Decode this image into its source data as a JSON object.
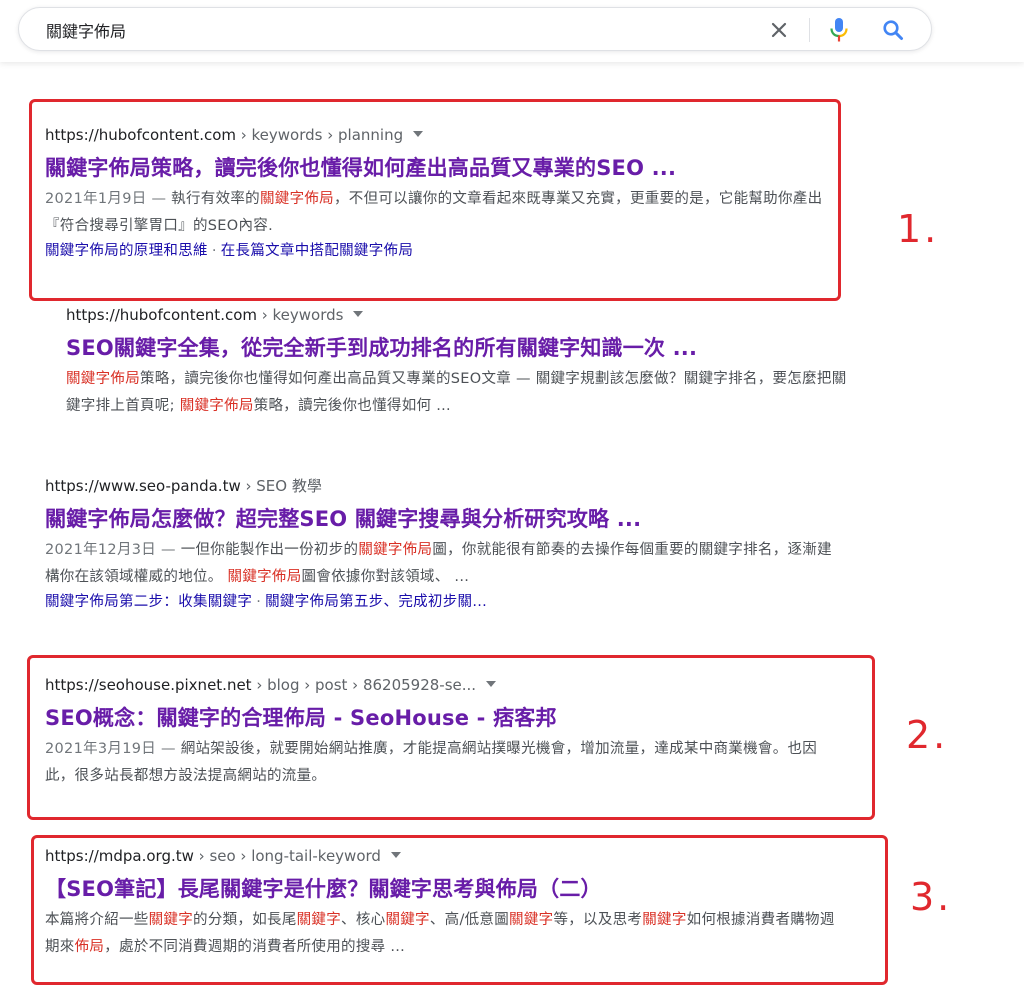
{
  "search": {
    "query": "關鍵字佈局",
    "clear_icon": "close-icon",
    "mic_icon": "microphone-icon",
    "search_icon": "search-icon"
  },
  "results": [
    {
      "url": "https://hubofcontent.com",
      "crumbs": " › keywords › planning",
      "title": "關鍵字佈局策略，讀完後你也懂得如何產出高品質又專業的SEO ...",
      "date": "2021年1月9日 — ",
      "snippet": [
        {
          "t": "執行有效率的",
          "hl": false
        },
        {
          "t": "關鍵字佈局",
          "hl": true
        },
        {
          "t": "，不但可以讓你的文章看起來既專業又充實，更重要的是，它能幫助你產出『符合搜尋引擎胃口』的SEO內容.",
          "hl": false
        }
      ],
      "sitelinks": [
        "關鍵字佈局的原理和思維",
        "在長篇文章中搭配關鍵字佈局"
      ]
    },
    {
      "url": "https://hubofcontent.com",
      "crumbs": " › keywords",
      "title": "SEO關鍵字全集，從完全新手到成功排名的所有關鍵字知識一次 ...",
      "date": "",
      "snippet": [
        {
          "t": "關鍵字佈局",
          "hl": true
        },
        {
          "t": "策略，讀完後你也懂得如何產出高品質又專業的SEO文章 — 關鍵字規劃該怎麼做？關鍵字排名，要怎麼把關鍵字排上首頁呢; ",
          "hl": false
        },
        {
          "t": "關鍵字佈局",
          "hl": true
        },
        {
          "t": "策略，讀完後你也懂得如何 ...",
          "hl": false
        }
      ],
      "sitelinks": []
    },
    {
      "url": "https://www.seo-panda.tw",
      "crumbs": " › SEO 教學",
      "title": "關鍵字佈局怎麼做？超完整SEO 關鍵字搜尋與分析研究攻略 ...",
      "date": "2021年12月3日 — ",
      "snippet": [
        {
          "t": "一但你能製作出一份初步的",
          "hl": false
        },
        {
          "t": "關鍵字佈局",
          "hl": true
        },
        {
          "t": "圖，你就能很有節奏的去操作每個重要的關鍵字排名，逐漸建構你在該領域權威的地位。 ",
          "hl": false
        },
        {
          "t": "關鍵字佈局",
          "hl": true
        },
        {
          "t": "圖會依據你對該領域、 ...",
          "hl": false
        }
      ],
      "sitelinks": [
        "關鍵字佈局第二步：收集關鍵字",
        "關鍵字佈局第五步、完成初步關..."
      ]
    },
    {
      "url": "https://seohouse.pixnet.net",
      "crumbs": " › blog › post › 86205928-se...",
      "title": "SEO概念：關鍵字的合理佈局 - SeoHouse - 痞客邦",
      "date": "2021年3月19日 — ",
      "snippet": [
        {
          "t": "網站架設後，就要開始網站推廣，才能提高網站撲曝光機會，增加流量，達成某中商業機會。也因此，很多站長都想方設法提高網站的流量。",
          "hl": false
        }
      ],
      "sitelinks": []
    },
    {
      "url": "https://mdpa.org.tw",
      "crumbs": " › seo › long-tail-keyword",
      "title": "【SEO筆記】長尾關鍵字是什麼？關鍵字思考與佈局（二）",
      "date": "",
      "snippet": [
        {
          "t": "本篇將介紹一些",
          "hl": false
        },
        {
          "t": "關鍵字",
          "hl": true
        },
        {
          "t": "的分類，如長尾",
          "hl": false
        },
        {
          "t": "關鍵字",
          "hl": true
        },
        {
          "t": "、核心",
          "hl": false
        },
        {
          "t": "關鍵字",
          "hl": true
        },
        {
          "t": "、高/低意圖",
          "hl": false
        },
        {
          "t": "關鍵字",
          "hl": true
        },
        {
          "t": "等，以及思考",
          "hl": false
        },
        {
          "t": "關鍵字",
          "hl": true
        },
        {
          "t": "如何根據消費者購物週期來",
          "hl": false
        },
        {
          "t": "佈局",
          "hl": true
        },
        {
          "t": "，處於不同消費週期的消費者所使用的搜尋 ...",
          "hl": false
        }
      ],
      "sitelinks": []
    }
  ],
  "annotations": {
    "label_1": "1.",
    "label_2": "2.",
    "label_3": "3.",
    "color": "#e0282e"
  }
}
